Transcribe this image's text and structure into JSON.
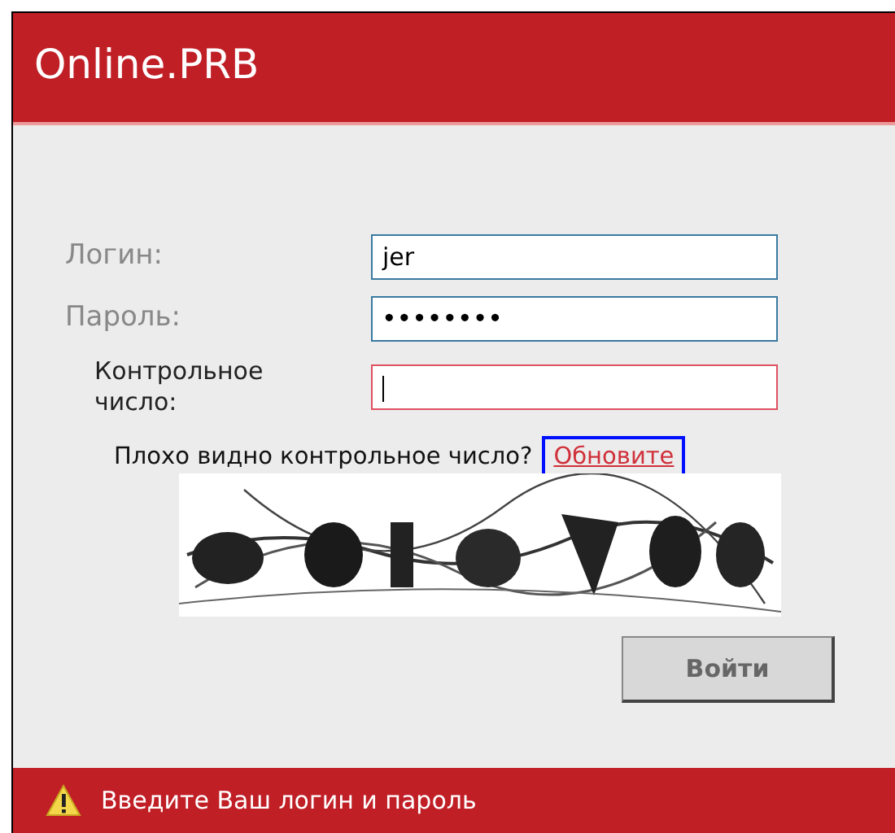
{
  "header": {
    "title": "Online.PRB"
  },
  "fields": [
    {
      "label": "Логин:",
      "value": "jer",
      "invalid": false,
      "focused": false,
      "emphasis": false
    },
    {
      "label": "Пароль:",
      "value": "••••••••",
      "invalid": false,
      "focused": false,
      "emphasis": false
    },
    {
      "label": "Контрольное число:",
      "invalid": true,
      "focused": true,
      "emphasis": true
    }
  ],
  "captcha": {
    "hint": "Плохо видно контрольное число?",
    "refresh_link": {
      "label": "Обновите",
      "focused": true
    }
  },
  "submit_button": {
    "label": "Войти"
  },
  "status_bar": {
    "message": "Введите Ваш логин и пароль"
  }
}
